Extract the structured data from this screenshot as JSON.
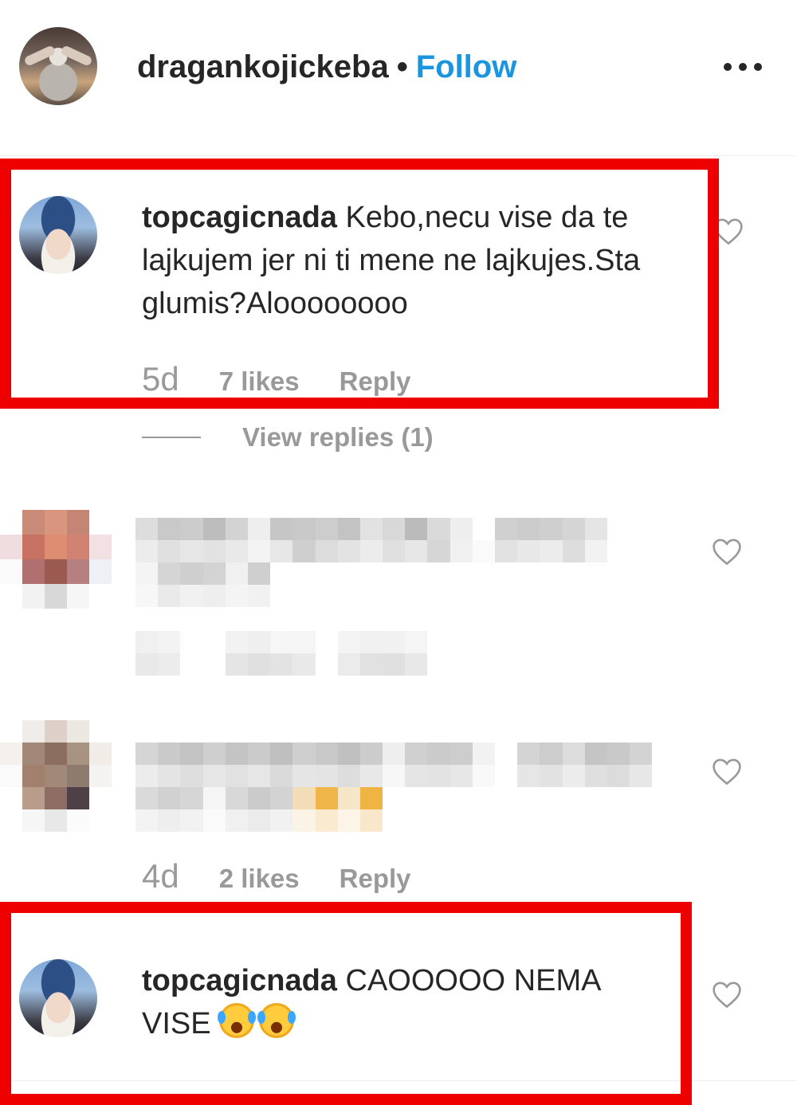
{
  "header": {
    "username": "dragankojickeba",
    "separator": "•",
    "follow_label": "Follow",
    "more_icon": "more-options-icon"
  },
  "comments": [
    {
      "username": "topcagicnada",
      "text": "Kebo,necu vise da te lajkujem jer ni ti mene ne lajkujes.Sta glumis?Aloooooooo",
      "age": "5d",
      "likes": "7 likes",
      "reply_label": "Reply",
      "view_replies": "View replies (1)",
      "highlighted": true
    },
    {
      "redacted": true,
      "age": "",
      "likes": "",
      "reply_label": ""
    },
    {
      "redacted": true,
      "age": "4d",
      "likes": "2 likes",
      "reply_label": "Reply"
    },
    {
      "username": "topcagicnada",
      "text": "CAOOOOO NEMA VISE",
      "emoji": "😂😂",
      "highlighted": true
    }
  ],
  "colors": {
    "accent": "#1b95e0",
    "highlight": "#ee0000",
    "meta": "#999999",
    "text": "#262626"
  }
}
